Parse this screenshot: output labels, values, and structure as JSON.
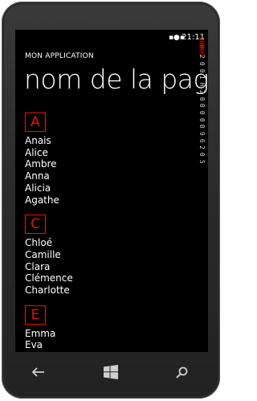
{
  "status_bar": {
    "time": "21:11",
    "icons": [
      "signal-icon",
      "battery-icon"
    ]
  },
  "app_title": "MON APPLICATION",
  "page_title": "nom de la page",
  "groups": [
    {
      "letter": "A",
      "items": [
        "Anais",
        "Alice",
        "Ambre",
        "Anna",
        "Alicia",
        "Agathe"
      ]
    },
    {
      "letter": "C",
      "items": [
        "Chloé",
        "Camille",
        "Clara",
        "Clémence",
        "Charlotte"
      ]
    },
    {
      "letter": "E",
      "items": [
        "Emma",
        "Eva"
      ]
    }
  ],
  "frame_counter": {
    "highlighted": [
      "000",
      "000"
    ],
    "lines": [
      "2",
      "0",
      "0",
      "1",
      "H",
      "2",
      "0",
      "0",
      "0",
      "0",
      "0",
      "9",
      "6",
      "2",
      "0",
      "5"
    ]
  },
  "nav": {
    "icons": [
      "back-arrow-icon",
      "windows-start-icon",
      "search-icon"
    ]
  },
  "colors": {
    "accent": "#e51400",
    "screen": "#000000",
    "bezel": "#2e2e2e"
  }
}
